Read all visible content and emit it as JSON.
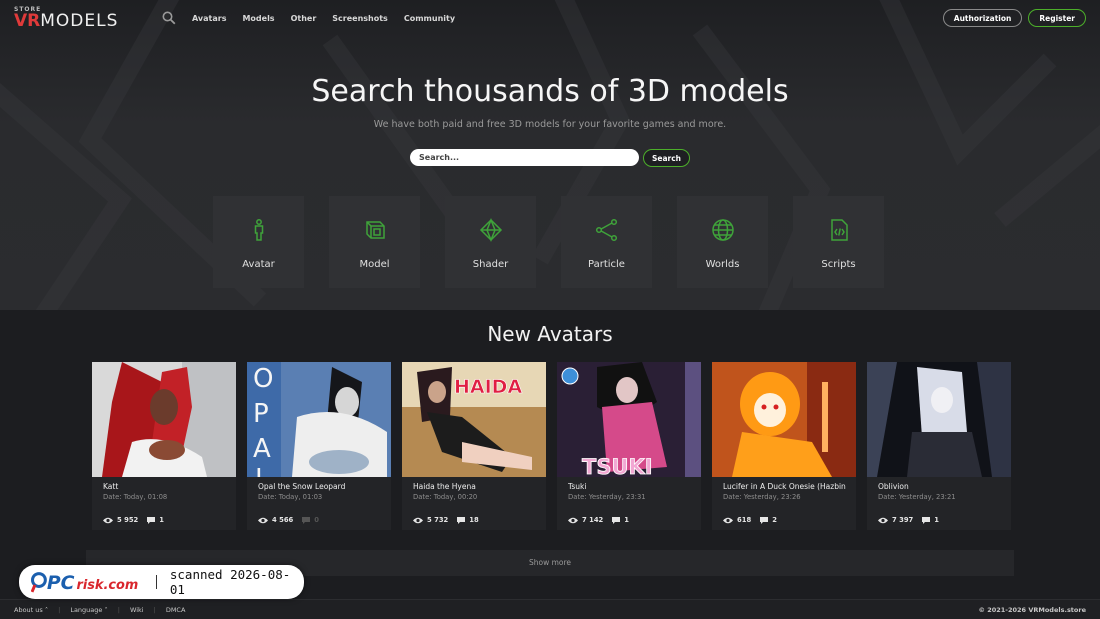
{
  "header": {
    "logo_top": "STORE",
    "logo_vr": "VR",
    "logo_models": "MODELS",
    "nav": [
      "Avatars",
      "Models",
      "Other",
      "Screenshots",
      "Community"
    ],
    "authorization": "Authorization",
    "register": "Register"
  },
  "hero": {
    "title": "Search thousands of 3D models",
    "subtitle": "We have both paid and free 3D models for your favorite games and more.",
    "search_placeholder": "Search...",
    "search_button": "Search"
  },
  "categories": [
    "Avatar",
    "Model",
    "Shader",
    "Particle",
    "Worlds",
    "Scripts"
  ],
  "section": {
    "title": "New Avatars",
    "cards": [
      {
        "name": "Katt",
        "date": "Date: Today, 01:08",
        "views": "5 952",
        "comments": "1"
      },
      {
        "name": "Opal the Snow Leopard",
        "date": "Date: Today, 01:03",
        "views": "4 566",
        "comments": "0"
      },
      {
        "name": "Haida the Hyena",
        "date": "Date: Today, 00:20",
        "views": "5 732",
        "comments": "18",
        "thumb_text": "HAIDA"
      },
      {
        "name": "Tsuki",
        "date": "Date: Yesterday, 23:31",
        "views": "7 142",
        "comments": "1",
        "thumb_text": "TSUKI"
      },
      {
        "name": "Lucifer in A Duck Onesie (Hazbin Hotel)",
        "date": "Date: Yesterday, 23:26",
        "views": "618",
        "comments": "2"
      },
      {
        "name": "Oblivion",
        "date": "Date: Yesterday, 23:21",
        "views": "7 397",
        "comments": "1"
      }
    ],
    "opal_text": "OPAL",
    "show_more": "Show more"
  },
  "footer": {
    "about": "About us",
    "language": "Language",
    "wiki": "Wiki",
    "dmca": "DMCA",
    "copyright": "© 2021-2026 VRModels.store"
  },
  "watermark": {
    "brand_pc": "PC",
    "brand_risk": "risk.com",
    "text": "scanned 2026-08-01"
  },
  "colors": {
    "accent_green": "#4caf2a",
    "logo_red": "#e03a3a",
    "icon_green": "#3fa33a"
  }
}
